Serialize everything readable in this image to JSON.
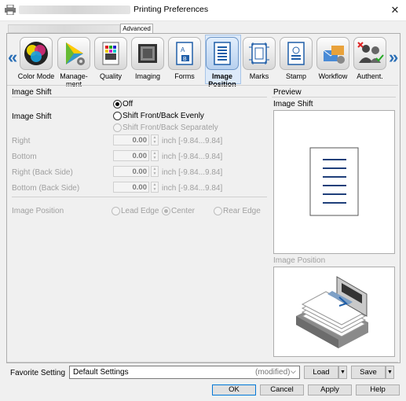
{
  "window": {
    "title": "Printing Preferences",
    "close_symbol": "✕"
  },
  "tabs": {
    "advanced": "Advanced"
  },
  "toolbar": {
    "items": [
      {
        "label": "Color Mode"
      },
      {
        "label": "Manage-\nment"
      },
      {
        "label": "Quality"
      },
      {
        "label": "Imaging"
      },
      {
        "label": "Forms"
      },
      {
        "label": "Image\nPosition"
      },
      {
        "label": "Marks"
      },
      {
        "label": "Stamp"
      },
      {
        "label": "Workflow"
      },
      {
        "label": "Authent."
      }
    ],
    "prev": "«",
    "next": "»"
  },
  "image_shift": {
    "group_title": "Image Shift",
    "label": "Image Shift",
    "options": [
      "Off",
      "Shift Front/Back Evenly",
      "Shift Front/Back Separately"
    ],
    "selected": "Off",
    "fields": [
      {
        "label": "Right",
        "value": "0.00",
        "unit": "inch [-9.84...9.84]"
      },
      {
        "label": "Bottom",
        "value": "0.00",
        "unit": "inch [-9.84...9.84]"
      },
      {
        "label": "Right (Back Side)",
        "value": "0.00",
        "unit": "inch [-9.84...9.84]"
      },
      {
        "label": "Bottom (Back Side)",
        "value": "0.00",
        "unit": "inch [-9.84...9.84]"
      }
    ]
  },
  "image_position": {
    "label": "Image Position",
    "options": [
      "Lead Edge",
      "Center",
      "Rear Edge"
    ],
    "selected": "Center"
  },
  "preview": {
    "title": "Preview",
    "shift_label": "Image Shift",
    "position_label": "Image Position"
  },
  "favorite": {
    "label": "Favorite Setting",
    "value": "Default Settings",
    "modified": "(modified)",
    "load": "Load",
    "save": "Save"
  },
  "buttons": {
    "ok": "OK",
    "cancel": "Cancel",
    "apply": "Apply",
    "help": "Help"
  }
}
